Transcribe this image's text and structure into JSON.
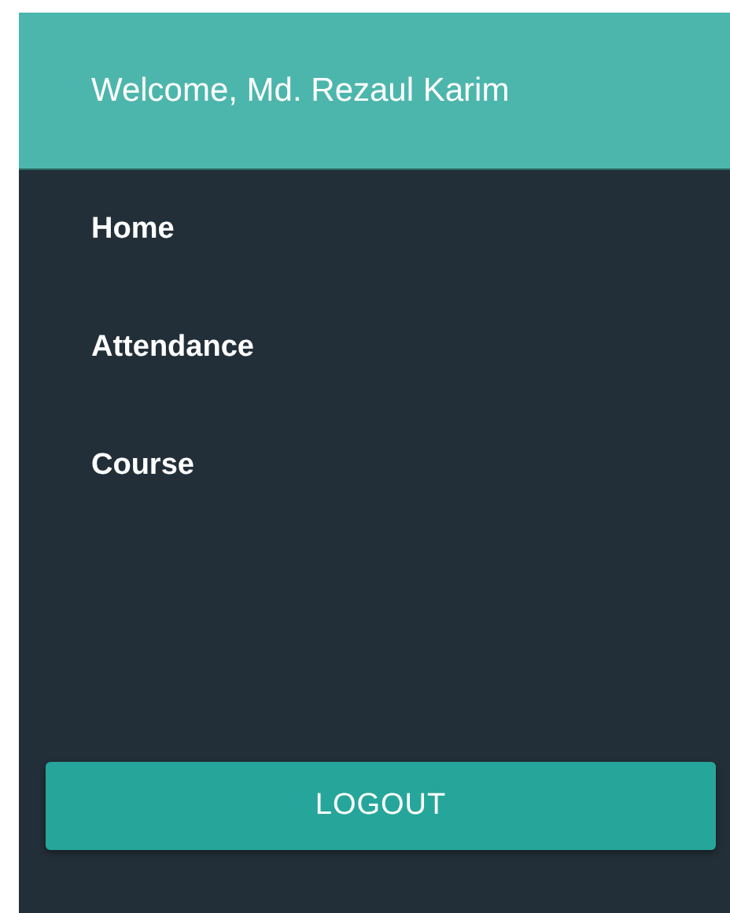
{
  "header": {
    "title": "Welcome, Md. Rezaul Karim"
  },
  "menu": [
    {
      "label": "Home"
    },
    {
      "label": "Attendance"
    },
    {
      "label": "Course"
    }
  ],
  "logout_button": {
    "label": "LOGOUT"
  }
}
